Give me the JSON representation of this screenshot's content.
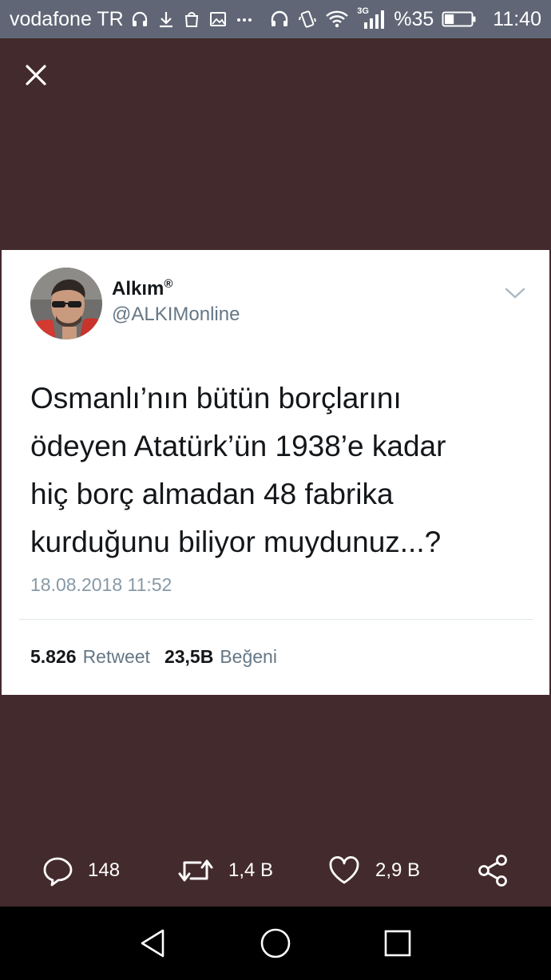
{
  "status_bar": {
    "carrier": "vodafone TR",
    "network": "3G",
    "battery": "%35",
    "battery_level": 0.35,
    "time": "11:40"
  },
  "tweet": {
    "author_name": "Alkım",
    "author_mark": "®",
    "author_handle": "@ALKIMonline",
    "text_lines": [
      "Osmanlı’nın bütün borçlarını",
      "ödeyen Atatürk’ün 1938’e kadar",
      "hiç borç almadan 48 fabrika",
      "kurduğunu biliyor muydunuz...?"
    ],
    "date": "18.08.2018 11:52",
    "retweet_count": "5.826",
    "retweet_label": "Retweet",
    "like_count": "23,5B",
    "like_label": "Beğeni"
  },
  "actions": {
    "reply_count": "148",
    "retweet_count": "1,4 B",
    "like_count": "2,9 B"
  },
  "icons": [
    "close-icon",
    "chevron-down-icon",
    "reply-icon",
    "retweet-icon",
    "heart-icon",
    "share-icon",
    "back-icon",
    "home-icon",
    "recents-icon"
  ],
  "colors": {
    "background": "#432a2c",
    "status_bar": "#606675",
    "card": "#ffffff",
    "secondary_text": "#657786"
  }
}
